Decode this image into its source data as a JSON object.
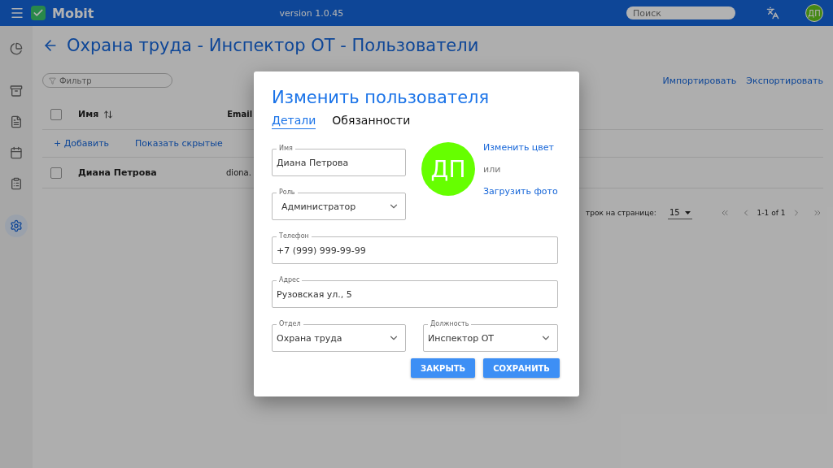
{
  "header": {
    "app_name": "Mobit",
    "version": "version 1.0.45",
    "search": {
      "placeholder": "Поиск"
    },
    "avatar": "ДП"
  },
  "sidebar": {
    "items": [
      {
        "selected": false
      },
      {
        "selected": false
      },
      {
        "selected": false
      },
      {
        "selected": false
      },
      {
        "selected": false
      },
      {
        "selected": true
      }
    ]
  },
  "page": {
    "title": "Охрана труда - Инспектор ОТ - Пользователи",
    "filter": {
      "placeholder": "Фильтр"
    },
    "actions": [
      "Импортировать",
      "Экспортировать"
    ],
    "table": {
      "select_all_checked": false,
      "columns": [
        "Имя",
        "Email"
      ],
      "add_link": "+ Добавить",
      "show_hidden_link": "Показать скрытые",
      "rows": [
        {
          "name": "Диана Петрова",
          "email": "diona.",
          "checked": false
        }
      ]
    },
    "pagination": {
      "rows_label": "трок на странице:",
      "rows_per_page": "15",
      "range": "1-1 of 1"
    }
  },
  "dialog": {
    "title": "Изменить пользователя",
    "tabs": [
      {
        "label": "Детали",
        "selected": true
      },
      {
        "label": "Обязанности",
        "selected": false
      }
    ],
    "avatar": {
      "initials": "ДП",
      "color": "#66ff00"
    },
    "change_color": "Изменить цвет",
    "or": "или",
    "upload_photo": "Загрузить фото",
    "fields": [
      {
        "kind": "text",
        "label": "Имя",
        "value": "Диана Петрова"
      },
      {
        "kind": "select",
        "label": "Роль",
        "value": "Администратор"
      },
      {
        "kind": "text",
        "label": "Телефон",
        "value": "+7 (999) 999-99-99"
      },
      {
        "kind": "text",
        "label": "Адрес",
        "value": "Рузовская ул., 5"
      },
      {
        "kind": "select",
        "label": "Отдел",
        "value": "Охрана труда"
      },
      {
        "kind": "select",
        "label": "Должность",
        "value": "Инспектор ОТ"
      }
    ],
    "buttons": [
      "ЗАКРЫТЬ",
      "СОХРАНИТЬ"
    ]
  }
}
